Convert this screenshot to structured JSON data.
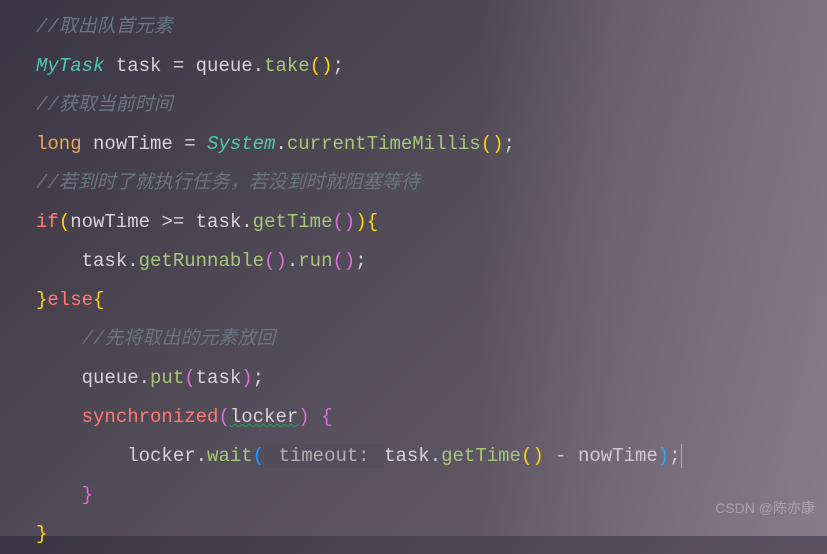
{
  "lines": {
    "l1_comment": "//取出队首元素",
    "l2_type": "MyTask",
    "l2_var": " task ",
    "l2_eq": "=",
    "l2_queue": " queue",
    "l2_dot": ".",
    "l2_method": "take",
    "l2_parens": "()",
    "l2_semi": ";",
    "l3_comment": "//获取当前时间",
    "l4_keyword": "long",
    "l4_var": " nowTime ",
    "l4_eq": "=",
    "l4_sp": " ",
    "l4_class": "System",
    "l4_dot": ".",
    "l4_method": "currentTimeMillis",
    "l4_parens": "()",
    "l4_semi": ";",
    "l5_comment": "//若到时了就执行任务，若没到时就阻塞等待",
    "l6_if": "if",
    "l6_open": "(",
    "l6_var1": "nowTime ",
    "l6_op": ">=",
    "l6_var2": " task",
    "l6_dot": ".",
    "l6_method": "getTime",
    "l6_parens": "()",
    "l6_close": ")",
    "l6_brace": "{",
    "l7_var": "task",
    "l7_dot1": ".",
    "l7_method1": "getRunnable",
    "l7_parens1": "()",
    "l7_dot2": ".",
    "l7_method2": "run",
    "l7_parens2": "()",
    "l7_semi": ";",
    "l8_close": "}",
    "l8_else": "else",
    "l8_open": "{",
    "l9_comment": "//先将取出的元素放回",
    "l10_var": "queue",
    "l10_dot": ".",
    "l10_method": "put",
    "l10_open": "(",
    "l10_arg": "task",
    "l10_close": ")",
    "l10_semi": ";",
    "l11_sync": "synchronized",
    "l11_open": "(",
    "l11_var": "locker",
    "l11_close": ")",
    "l11_sp": " ",
    "l11_brace": "{",
    "l12_var": "locker",
    "l12_dot": ".",
    "l12_method": "wait",
    "l12_open": "(",
    "l12_hint": " timeout: ",
    "l12_arg1": "task",
    "l12_dot2": ".",
    "l12_method2": "getTime",
    "l12_parens": "()",
    "l12_sp": " ",
    "l12_op": "-",
    "l12_sp2": " nowTime",
    "l12_close": ")",
    "l12_semi": ";",
    "l13_close": "}",
    "l14_close": "}"
  },
  "watermark": "CSDN @陈亦康"
}
